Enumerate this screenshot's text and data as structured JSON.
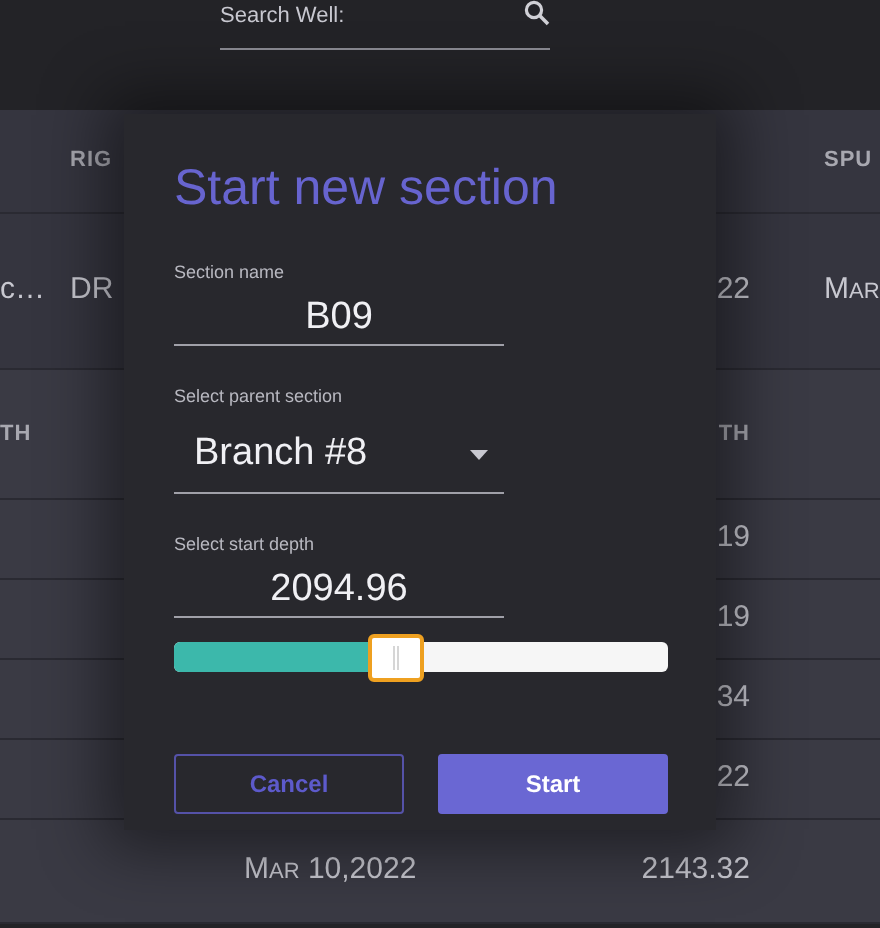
{
  "search": {
    "label": "Search Well:"
  },
  "table": {
    "header_1": {
      "column_2": "RIG",
      "column_5": "SPU"
    },
    "row_1": {
      "column_1": "c…",
      "column_2": "DR",
      "column_4": "22",
      "column_5": "Mar"
    },
    "header_2": {
      "column_1": "TH",
      "column_4": "TH"
    },
    "rows": [
      {
        "column_4": "19"
      },
      {
        "column_4": "19"
      },
      {
        "column_4": "34"
      },
      {
        "column_4": "22"
      },
      {
        "column_3": "Mar 10,2022",
        "column_4": "2143.32"
      }
    ]
  },
  "dialog": {
    "title": "Start new section",
    "section_name": {
      "label": "Section name",
      "value": "B09"
    },
    "parent_section": {
      "label": "Select parent section",
      "value": "Branch #8"
    },
    "start_depth": {
      "label": "Select start depth",
      "value": "2094.96",
      "level": 0.45
    },
    "buttons": [
      {
        "label": "Cancel",
        "kind": "secondary"
      },
      {
        "label": "Start",
        "kind": "primary"
      }
    ]
  }
}
